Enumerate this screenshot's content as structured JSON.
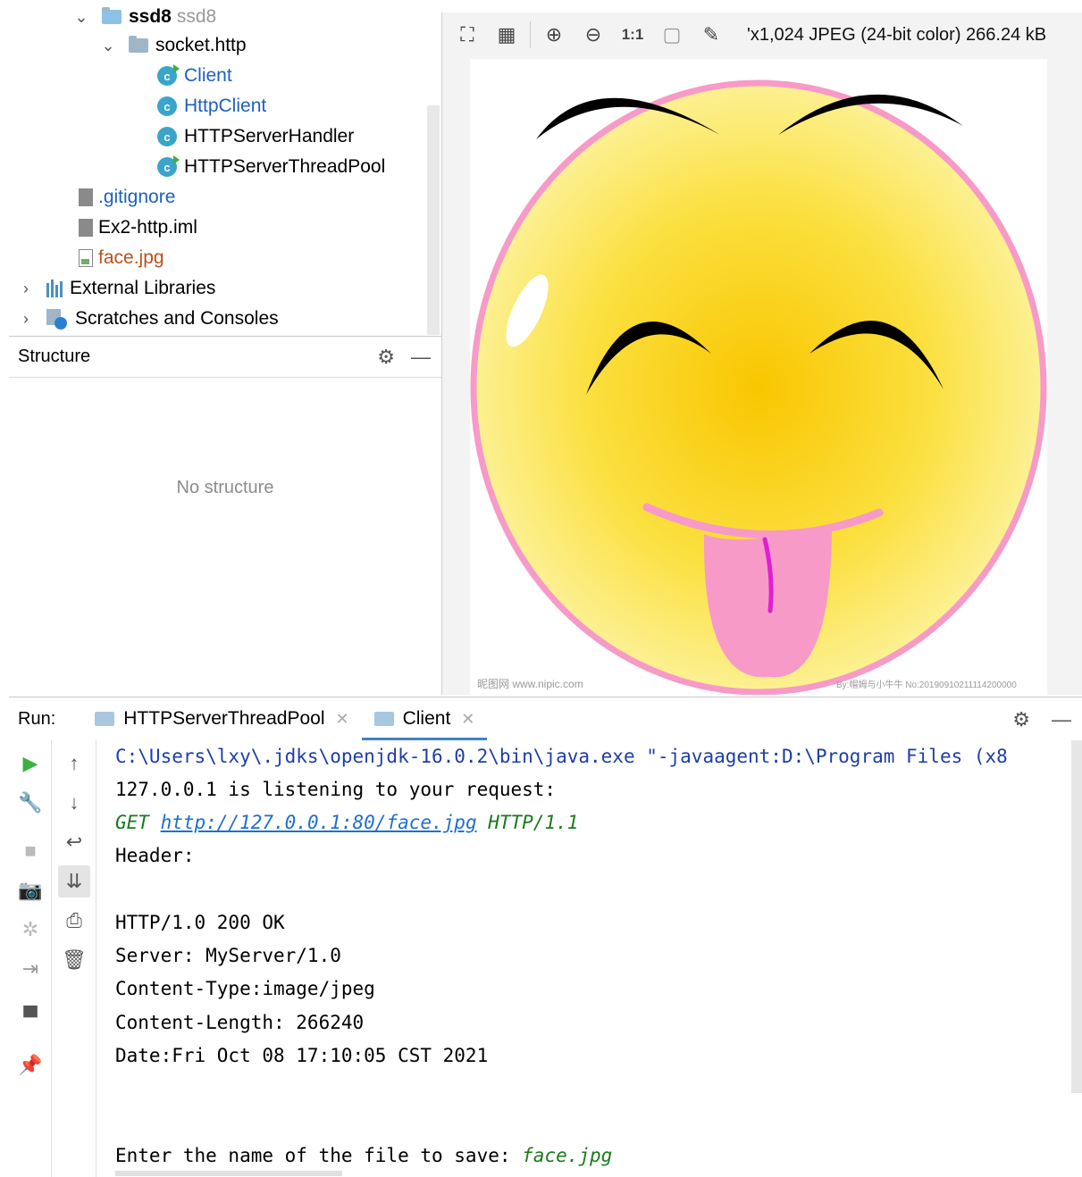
{
  "project_tree": {
    "items": [
      {
        "label": "ssd8",
        "secondary": "ssd8",
        "type": "folder",
        "expanded": true
      },
      {
        "label": "socket.http",
        "type": "package",
        "expanded": true
      },
      {
        "label": "Client",
        "type": "class-runnable"
      },
      {
        "label": "HttpClient",
        "type": "class"
      },
      {
        "label": "HTTPServerHandler",
        "type": "class"
      },
      {
        "label": "HTTPServerThreadPool",
        "type": "class-runnable"
      },
      {
        "label": ".gitignore",
        "type": "file-ignored"
      },
      {
        "label": "Ex2-http.iml",
        "type": "file-module"
      },
      {
        "label": "face.jpg",
        "type": "file-image"
      },
      {
        "label": "External Libraries",
        "type": "libraries",
        "expanded": false
      },
      {
        "label": "Scratches and Consoles",
        "type": "scratches",
        "expanded": false
      }
    ],
    "colors": {
      "class_label": "#1f5fbf",
      "gitignore_label": "#1f5fbf",
      "image_label": "#b5531c"
    }
  },
  "structure": {
    "title": "Structure",
    "empty_text": "No structure"
  },
  "image_viewer": {
    "info": "'x1,024 JPEG (24-bit color) 266.24 kB",
    "actual_size_label": "1:1",
    "image_alt": "Smiley face sticking out tongue",
    "watermark_left": "昵图网 www.nipic.com",
    "watermark_right": "By:帽姆与小牛牛 No:20190910211114200000"
  },
  "run": {
    "label": "Run:",
    "tabs": [
      {
        "label": "HTTPServerThreadPool",
        "active": false
      },
      {
        "label": "Client",
        "active": true
      }
    ],
    "console": {
      "command": "C:\\Users\\lxy\\.jdks\\openjdk-16.0.2\\bin\\java.exe \"-javaagent:D:\\Program Files (x8",
      "listening": "127.0.0.1 is listening to your request:",
      "get_prefix": "GET ",
      "get_url": "http://127.0.0.1:80/face.jpg",
      "get_suffix": " HTTP/1.1",
      "header": "Header:",
      "status": "HTTP/1.0 200 OK",
      "server": "Server: MyServer/1.0",
      "content_type": "Content-Type:image/jpeg",
      "content_length": "Content-Length: 266240",
      "date": "Date:Fri Oct 08 17:10:05 CST 2021",
      "prompt": "Enter the name of the file to save: ",
      "input": "face.jpg"
    }
  }
}
